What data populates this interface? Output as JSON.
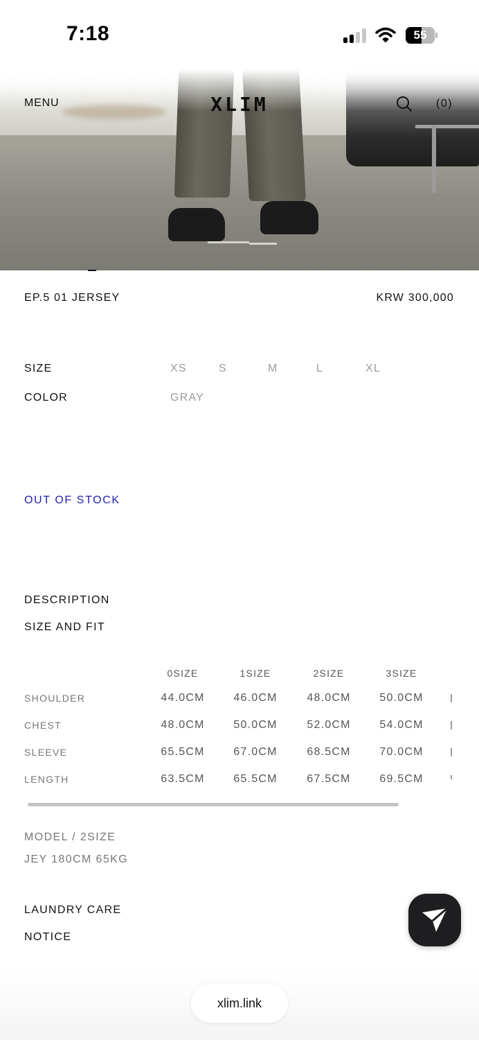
{
  "status_bar": {
    "time": "7:18",
    "battery": "55",
    "battery_level": 0.55
  },
  "header": {
    "menu_label": "MENU",
    "logo": "XLIM",
    "cart_label": "(0)"
  },
  "product": {
    "title": "EP.5 01 JERSEY",
    "price": "KRW 300,000",
    "size_label": "SIZE",
    "sizes": [
      "XS",
      "S",
      "M",
      "L",
      "XL"
    ],
    "color_label": "COLOR",
    "color_value": "GRAY",
    "stock_status": "OUT OF STOCK"
  },
  "sections": {
    "description": "DESCRIPTION",
    "size_and_fit": "SIZE AND FIT",
    "laundry_care": "LAUNDRY CARE",
    "notice": "NOTICE"
  },
  "size_table": {
    "columns": [
      "0SIZE",
      "1SIZE",
      "2SIZE",
      "3SIZE"
    ],
    "rows": [
      {
        "label": "SHOULDER",
        "values": [
          "44.0CM",
          "46.0CM",
          "48.0CM",
          "50.0CM"
        ]
      },
      {
        "label": "CHEST",
        "values": [
          "48.0CM",
          "50.0CM",
          "52.0CM",
          "54.0CM"
        ]
      },
      {
        "label": "SLEEVE",
        "values": [
          "65.5CM",
          "67.0CM",
          "68.5CM",
          "70.0CM"
        ]
      },
      {
        "label": "LENGTH",
        "values": [
          "63.5CM",
          "65.5CM",
          "67.5CM",
          "69.5CM"
        ]
      }
    ]
  },
  "model_info": {
    "line1": "MODEL / 2SIZE",
    "line2": "JEY 180CM 65KG"
  },
  "browser": {
    "url": "xlim.link"
  },
  "colors": {
    "stock_accent": "#1f1fb6",
    "fab_background": "#1e1e20"
  },
  "icons": {
    "search": "search-icon",
    "send": "send-arrow-icon"
  }
}
